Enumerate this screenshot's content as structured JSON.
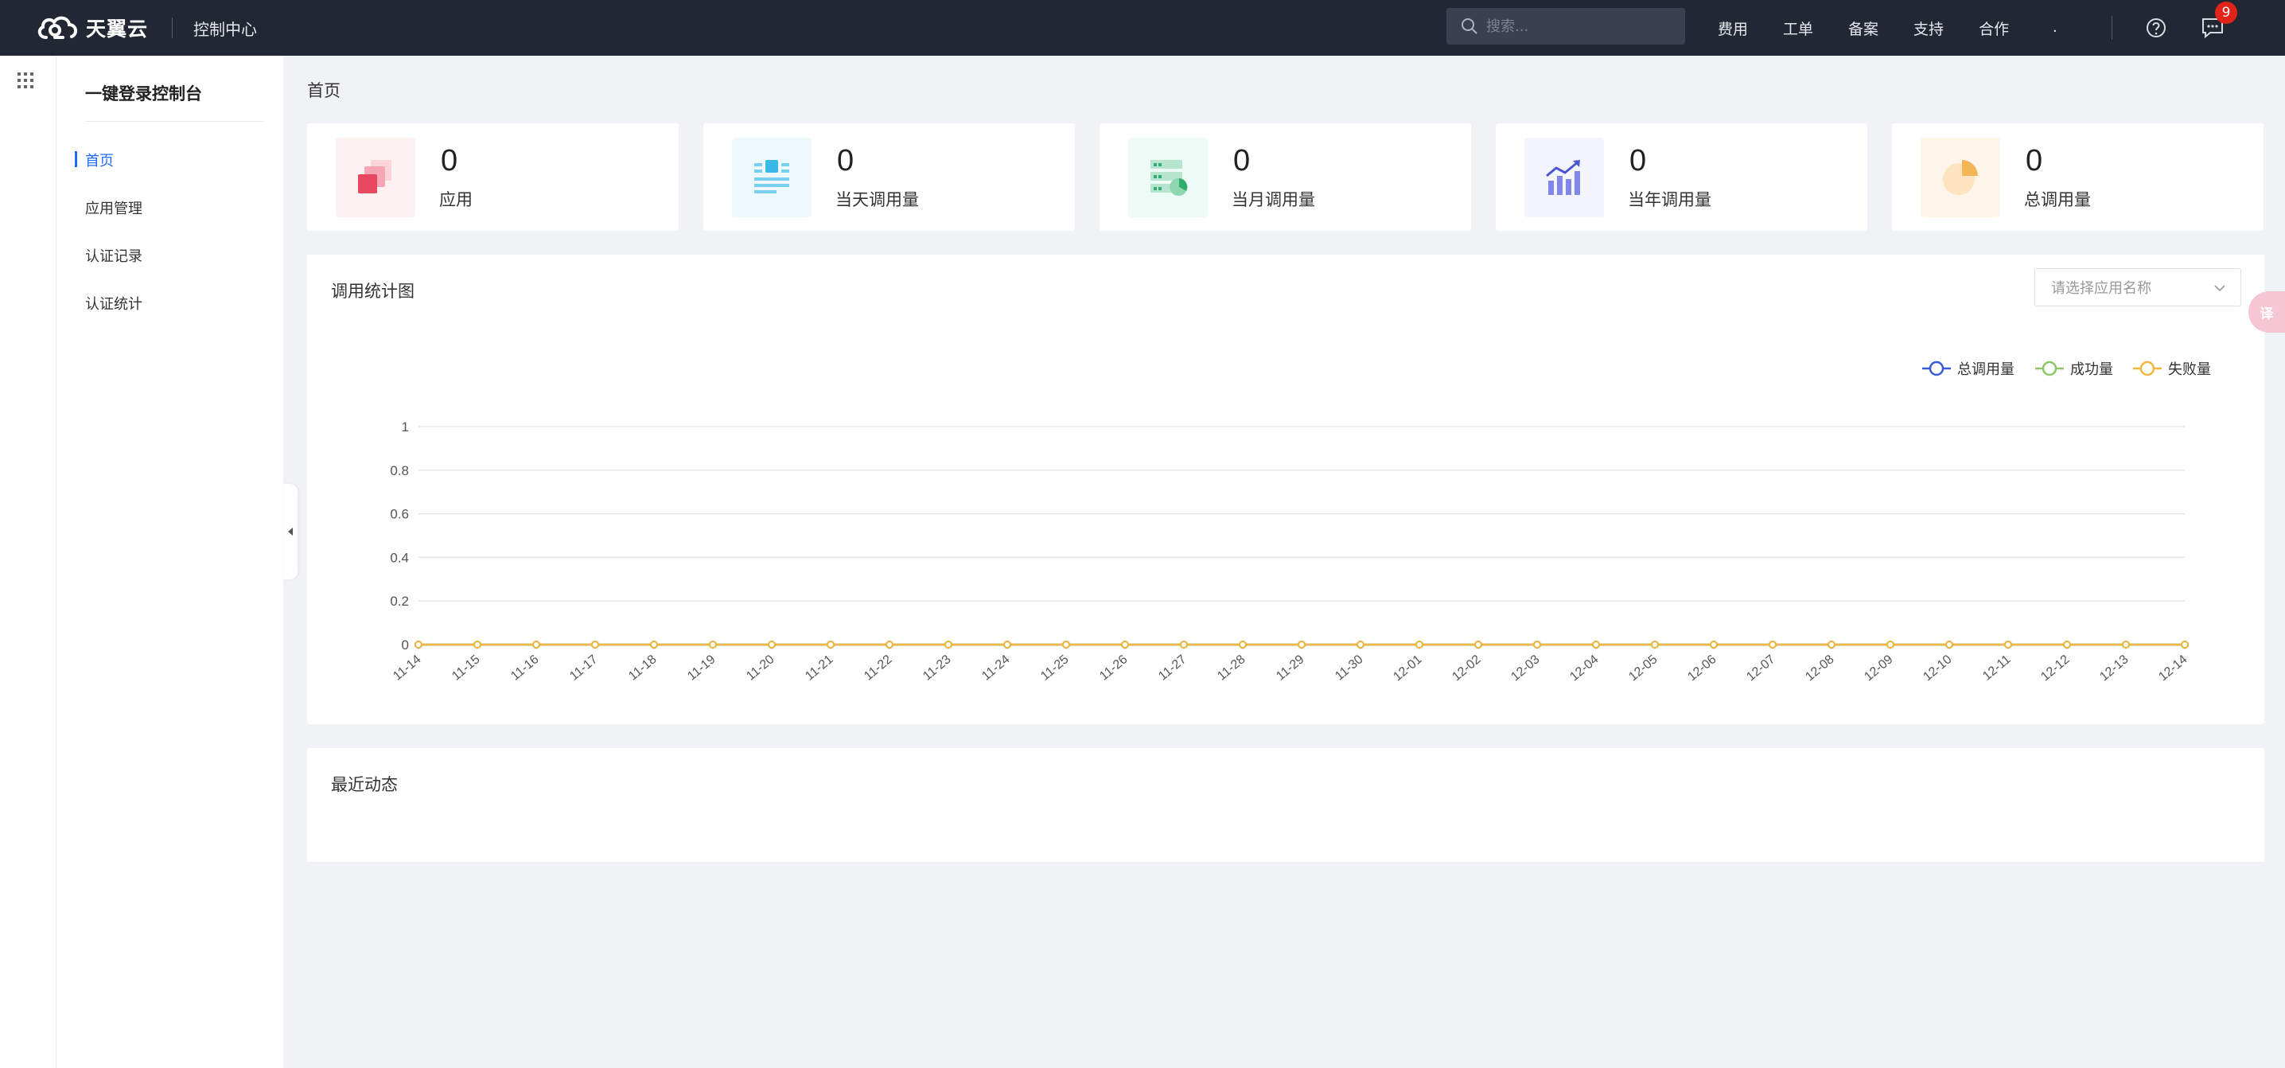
{
  "topbar": {
    "brand": "天翼云",
    "console_title": "控制中心",
    "search_placeholder": "搜索...",
    "nav": [
      "费用",
      "工单",
      "备案",
      "支持",
      "合作"
    ],
    "account_name": ".",
    "notification_count": "9"
  },
  "sidebar": {
    "title": "一键登录控制台",
    "items": [
      {
        "label": "首页",
        "active": true
      },
      {
        "label": "应用管理",
        "active": false
      },
      {
        "label": "认证记录",
        "active": false
      },
      {
        "label": "认证统计",
        "active": false
      }
    ]
  },
  "breadcrumb": "首页",
  "stats": [
    {
      "value": "0",
      "label": "应用",
      "icon": "app-stack-icon",
      "bg": "#fdf1f2"
    },
    {
      "value": "0",
      "label": "当天调用量",
      "icon": "list-doc-icon",
      "bg": "#eef9fd"
    },
    {
      "value": "0",
      "label": "当月调用量",
      "icon": "server-pie-icon",
      "bg": "#eefaf6"
    },
    {
      "value": "0",
      "label": "当年调用量",
      "icon": "bar-trend-icon",
      "bg": "#f4f4fd"
    },
    {
      "value": "0",
      "label": "总调用量",
      "icon": "pie-chart-icon",
      "bg": "#fef5ea"
    }
  ],
  "chart_panel": {
    "title": "调用统计图",
    "select_placeholder": "请选择应用名称"
  },
  "chart_data": {
    "type": "line",
    "x": [
      "11-14",
      "11-15",
      "11-16",
      "11-17",
      "11-18",
      "11-19",
      "11-20",
      "11-21",
      "11-22",
      "11-23",
      "11-24",
      "11-25",
      "11-26",
      "11-27",
      "11-28",
      "11-29",
      "11-30",
      "12-01",
      "12-02",
      "12-03",
      "12-04",
      "12-05",
      "12-06",
      "12-07",
      "12-08",
      "12-09",
      "12-10",
      "12-11",
      "12-12",
      "12-13",
      "12-14"
    ],
    "series": [
      {
        "name": "总调用量",
        "color": "#3a5bd9",
        "values": [
          0,
          0,
          0,
          0,
          0,
          0,
          0,
          0,
          0,
          0,
          0,
          0,
          0,
          0,
          0,
          0,
          0,
          0,
          0,
          0,
          0,
          0,
          0,
          0,
          0,
          0,
          0,
          0,
          0,
          0,
          0
        ]
      },
      {
        "name": "成功量",
        "color": "#8cc56a",
        "values": [
          0,
          0,
          0,
          0,
          0,
          0,
          0,
          0,
          0,
          0,
          0,
          0,
          0,
          0,
          0,
          0,
          0,
          0,
          0,
          0,
          0,
          0,
          0,
          0,
          0,
          0,
          0,
          0,
          0,
          0,
          0
        ]
      },
      {
        "name": "失败量",
        "color": "#f0b63e",
        "values": [
          0,
          0,
          0,
          0,
          0,
          0,
          0,
          0,
          0,
          0,
          0,
          0,
          0,
          0,
          0,
          0,
          0,
          0,
          0,
          0,
          0,
          0,
          0,
          0,
          0,
          0,
          0,
          0,
          0,
          0,
          0
        ]
      }
    ],
    "yticks": [
      "0",
      "0.2",
      "0.4",
      "0.6",
      "0.8",
      "1"
    ],
    "ylim": [
      0,
      1
    ],
    "grid": true,
    "legend": "top-right"
  },
  "recent_panel": {
    "title": "最近动态"
  },
  "translate_float": "译"
}
